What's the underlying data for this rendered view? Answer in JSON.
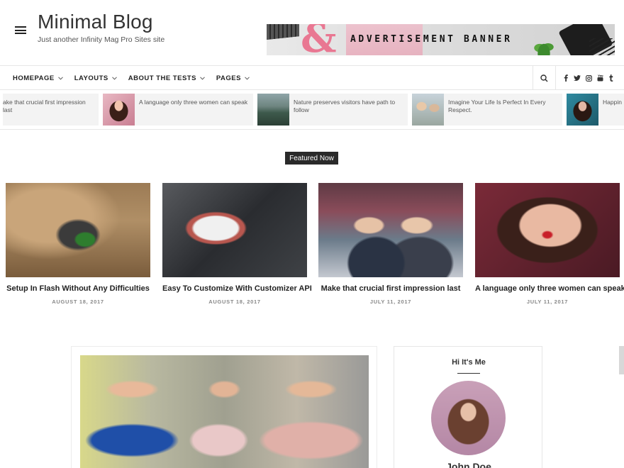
{
  "site": {
    "title": "Minimal Blog",
    "tagline": "Just another Infinity Mag Pro Sites site"
  },
  "ad": {
    "text": "ADVERTISEMENT BANNER"
  },
  "nav": {
    "items": [
      {
        "label": "HOMEPAGE"
      },
      {
        "label": "LAYOUTS"
      },
      {
        "label": "ABOUT THE TESTS"
      },
      {
        "label": "PAGES"
      }
    ],
    "social": [
      "f",
      "t",
      "ig",
      "yt",
      "t"
    ]
  },
  "ticker": [
    {
      "title": "ake that crucial first impression last"
    },
    {
      "title": "A language only three women can speak"
    },
    {
      "title": "Nature preserves visitors have path to follow"
    },
    {
      "title": "Imagine Your Life Is Perfect In Every Respect."
    },
    {
      "title": "Happin"
    }
  ],
  "featured": {
    "label": "Featured Now",
    "cards": [
      {
        "title": "Setup In Flash Without Any Difficulties",
        "date": "AUGUST 18, 2017"
      },
      {
        "title": "Easy To Customize With Customizer API",
        "date": "AUGUST 18, 2017"
      },
      {
        "title": "Make that crucial first impression last",
        "date": "JULY 11, 2017"
      },
      {
        "title": "A language only three women can speak",
        "date": "JULY 11, 2017"
      }
    ]
  },
  "widget": {
    "title": "Hi It's Me",
    "name": "John Doe"
  },
  "colors": {
    "accent_pink": "#e97792",
    "dark": "#2a2a2a",
    "border": "#e6e6e6",
    "muted_text": "#888888"
  },
  "icons": {
    "menu": "hamburger-icon",
    "search": "search-icon",
    "chevron": "chevron-down-icon"
  }
}
